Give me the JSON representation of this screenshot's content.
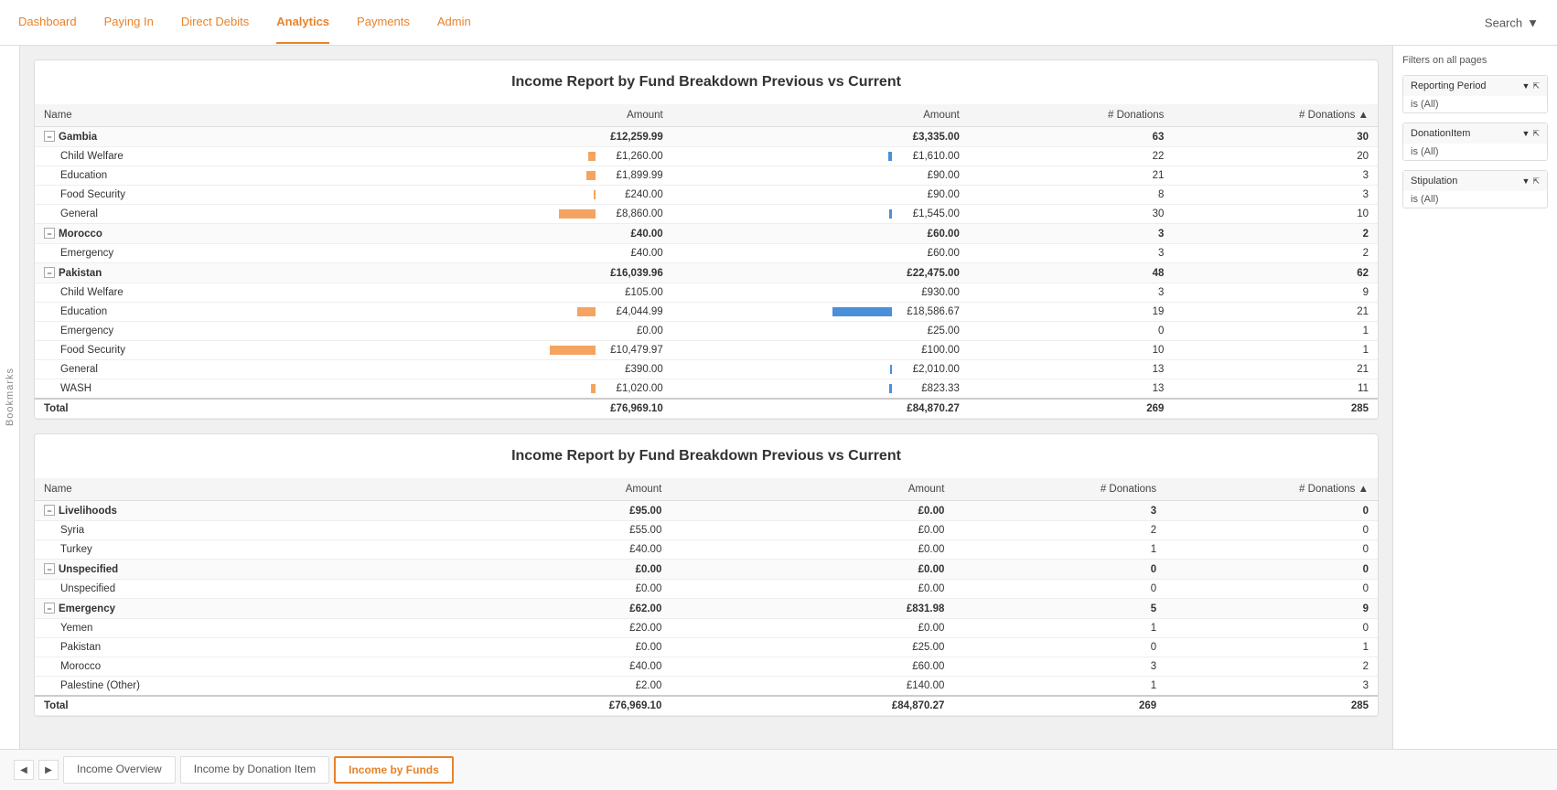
{
  "nav": {
    "items": [
      {
        "label": "Dashboard",
        "active": false
      },
      {
        "label": "Paying In",
        "active": false
      },
      {
        "label": "Direct Debits",
        "active": false
      },
      {
        "label": "Analytics",
        "active": true
      },
      {
        "label": "Payments",
        "active": false
      },
      {
        "label": "Admin",
        "active": false
      }
    ],
    "search_label": "Search"
  },
  "bookmarks": {
    "label": "Bookmarks"
  },
  "report1": {
    "title": "Income Report by Fund Breakdown Previous vs Current",
    "columns": [
      "Name",
      "Amount",
      "Amount",
      "# Donations",
      "# Donations"
    ],
    "rows": [
      {
        "type": "group",
        "name": "Gambia",
        "amt1": "£12,259.99",
        "amt2": "£3,335.00",
        "don1": "63",
        "don2": "30",
        "bar1": 55,
        "bar2": 0
      },
      {
        "type": "sub",
        "name": "Child Welfare",
        "amt1": "£1,260.00",
        "amt2": "£1,610.00",
        "don1": "22",
        "don2": "20",
        "bar1": 8,
        "bar2": 4
      },
      {
        "type": "sub",
        "name": "Education",
        "amt1": "£1,899.99",
        "amt2": "£90.00",
        "don1": "21",
        "don2": "3",
        "bar1": 10,
        "bar2": 0
      },
      {
        "type": "sub",
        "name": "Food Security",
        "amt1": "£240.00",
        "amt2": "£90.00",
        "don1": "8",
        "don2": "3",
        "bar1": 2,
        "bar2": 0
      },
      {
        "type": "sub",
        "name": "General",
        "amt1": "£8,860.00",
        "amt2": "£1,545.00",
        "don1": "30",
        "don2": "10",
        "bar1": 40,
        "bar2": 3
      },
      {
        "type": "group",
        "name": "Morocco",
        "amt1": "£40.00",
        "amt2": "£60.00",
        "don1": "3",
        "don2": "2",
        "bar1": 0,
        "bar2": 0
      },
      {
        "type": "sub",
        "name": "Emergency",
        "amt1": "£40.00",
        "amt2": "£60.00",
        "don1": "3",
        "don2": "2",
        "bar1": 0,
        "bar2": 0
      },
      {
        "type": "group",
        "name": "Pakistan",
        "amt1": "£16,039.96",
        "amt2": "£22,475.00",
        "don1": "48",
        "don2": "62",
        "bar1": 0,
        "bar2": 0
      },
      {
        "type": "sub",
        "name": "Child Welfare",
        "amt1": "£105.00",
        "amt2": "£930.00",
        "don1": "3",
        "don2": "9",
        "bar1": 0,
        "bar2": 0
      },
      {
        "type": "sub",
        "name": "Education",
        "amt1": "£4,044.99",
        "amt2": "£18,586.67",
        "don1": "19",
        "don2": "21",
        "bar1": 20,
        "bar2": 65
      },
      {
        "type": "sub",
        "name": "Emergency",
        "amt1": "£0.00",
        "amt2": "£25.00",
        "don1": "0",
        "don2": "1",
        "bar1": 0,
        "bar2": 0
      },
      {
        "type": "sub",
        "name": "Food Security",
        "amt1": "£10,479.97",
        "amt2": "£100.00",
        "don1": "10",
        "don2": "1",
        "bar1": 50,
        "bar2": 0
      },
      {
        "type": "sub",
        "name": "General",
        "amt1": "£390.00",
        "amt2": "£2,010.00",
        "don1": "13",
        "don2": "21",
        "bar1": 0,
        "bar2": 2
      },
      {
        "type": "sub",
        "name": "WASH",
        "amt1": "£1,020.00",
        "amt2": "£823.33",
        "don1": "13",
        "don2": "11",
        "bar1": 5,
        "bar2": 3
      },
      {
        "type": "total",
        "name": "Total",
        "amt1": "£76,969.10",
        "amt2": "£84,870.27",
        "don1": "269",
        "don2": "285",
        "bar1": 0,
        "bar2": 0
      }
    ]
  },
  "report2": {
    "title": "Income Report by Fund Breakdown Previous vs Current",
    "columns": [
      "Name",
      "Amount",
      "Amount",
      "# Donations",
      "# Donations"
    ],
    "rows": [
      {
        "type": "group",
        "name": "Livelihoods",
        "amt1": "£95.00",
        "amt2": "£0.00",
        "don1": "3",
        "don2": "0",
        "bar1": 0,
        "bar2": 0
      },
      {
        "type": "sub",
        "name": "Syria",
        "amt1": "£55.00",
        "amt2": "£0.00",
        "don1": "2",
        "don2": "0",
        "bar1": 0,
        "bar2": 0
      },
      {
        "type": "sub",
        "name": "Turkey",
        "amt1": "£40.00",
        "amt2": "£0.00",
        "don1": "1",
        "don2": "0",
        "bar1": 0,
        "bar2": 0
      },
      {
        "type": "group",
        "name": "Unspecified",
        "amt1": "£0.00",
        "amt2": "£0.00",
        "don1": "0",
        "don2": "0",
        "bar1": 0,
        "bar2": 0
      },
      {
        "type": "sub",
        "name": "Unspecified",
        "amt1": "£0.00",
        "amt2": "£0.00",
        "don1": "0",
        "don2": "0",
        "bar1": 0,
        "bar2": 0
      },
      {
        "type": "group",
        "name": "Emergency",
        "amt1": "£62.00",
        "amt2": "£831.98",
        "don1": "5",
        "don2": "9",
        "bar1": 0,
        "bar2": 0
      },
      {
        "type": "sub",
        "name": "Yemen",
        "amt1": "£20.00",
        "amt2": "£0.00",
        "don1": "1",
        "don2": "0",
        "bar1": 0,
        "bar2": 0
      },
      {
        "type": "sub",
        "name": "Pakistan",
        "amt1": "£0.00",
        "amt2": "£25.00",
        "don1": "0",
        "don2": "1",
        "bar1": 0,
        "bar2": 0
      },
      {
        "type": "sub",
        "name": "Morocco",
        "amt1": "£40.00",
        "amt2": "£60.00",
        "don1": "3",
        "don2": "2",
        "bar1": 0,
        "bar2": 0
      },
      {
        "type": "sub",
        "name": "Palestine (Other)",
        "amt1": "£2.00",
        "amt2": "£140.00",
        "don1": "1",
        "don2": "3",
        "bar1": 0,
        "bar2": 0
      },
      {
        "type": "total",
        "name": "Total",
        "amt1": "£76,969.10",
        "amt2": "£84,870.27",
        "don1": "269",
        "don2": "285",
        "bar1": 0,
        "bar2": 0
      }
    ]
  },
  "filters": {
    "title": "Filters on all pages",
    "items": [
      {
        "label": "Reporting Period",
        "value": "is (All)"
      },
      {
        "label": "DonationItem",
        "value": "is (All)"
      },
      {
        "label": "Stipulation",
        "value": "is (All)"
      }
    ]
  },
  "bottom_tabs": {
    "tabs": [
      {
        "label": "Income Overview",
        "active": false
      },
      {
        "label": "Income by Donation Item",
        "active": false
      },
      {
        "label": "Income by Funds",
        "active": true
      }
    ]
  }
}
